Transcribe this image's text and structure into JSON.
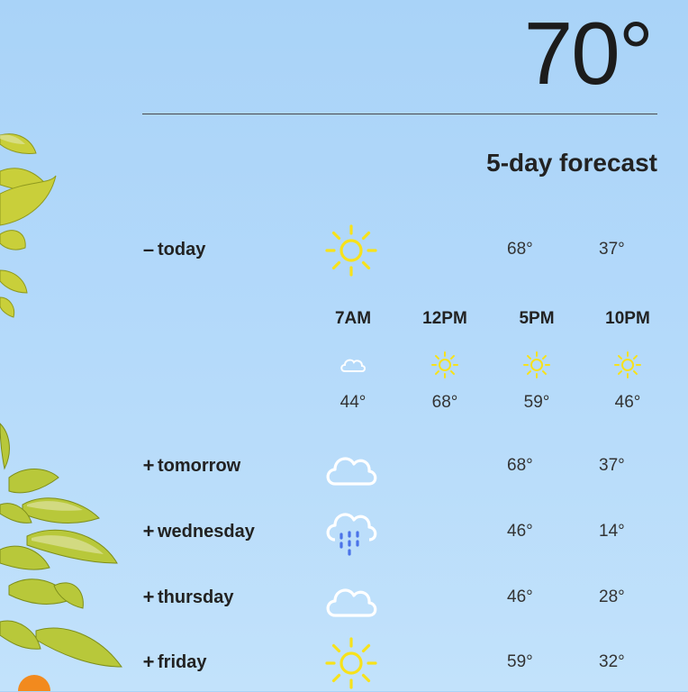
{
  "current": {
    "temperature": "70°"
  },
  "forecast_title": "5-day forecast",
  "colors": {
    "sun": "#f7e21b",
    "rain": "#4b73e8",
    "cloud_stroke": "#ffffff"
  },
  "days": [
    {
      "toggle": "–",
      "label": "today",
      "icon": "sun-icon",
      "high": "68°",
      "low": "37°",
      "expanded": true
    },
    {
      "toggle": "+",
      "label": "tomorrow",
      "icon": "cloud-icon",
      "high": "68°",
      "low": "37°",
      "expanded": false
    },
    {
      "toggle": "+",
      "label": "wednesday",
      "icon": "rain-icon",
      "high": "46°",
      "low": "14°",
      "expanded": false
    },
    {
      "toggle": "+",
      "label": "thursday",
      "icon": "cloud-icon",
      "high": "46°",
      "low": "28°",
      "expanded": false
    },
    {
      "toggle": "+",
      "label": "friday",
      "icon": "sun-icon",
      "high": "59°",
      "low": "32°",
      "expanded": false
    }
  ],
  "hourly": [
    {
      "time": "7AM",
      "icon": "cloud-icon",
      "temp": "44°"
    },
    {
      "time": "12PM",
      "icon": "sun-icon",
      "temp": "68°"
    },
    {
      "time": "5PM",
      "icon": "sun-icon",
      "temp": "59°"
    },
    {
      "time": "10PM",
      "icon": "sun-icon",
      "temp": "46°"
    }
  ]
}
